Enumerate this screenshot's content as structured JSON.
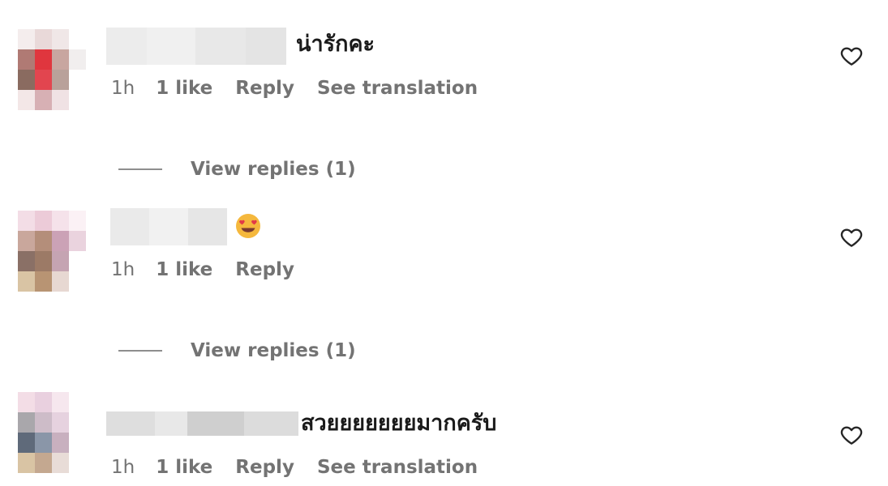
{
  "comments": [
    {
      "text": "น่ารักคะ",
      "time": "1h",
      "likes": "1 like",
      "reply_label": "Reply",
      "translation_label": "See translation",
      "view_replies": "View replies (1)"
    },
    {
      "emoji": "smiling-face-with-heart-eyes",
      "time": "1h",
      "likes": "1 like",
      "reply_label": "Reply",
      "view_replies": "View replies (1)"
    },
    {
      "text": "สวยยยยยยยมากครับ",
      "time": "1h",
      "likes": "1 like",
      "reply_label": "Reply",
      "translation_label": "See translation"
    }
  ],
  "icons": {
    "like": "heart-outline-icon"
  },
  "colors": {
    "secondary_text": "#737373",
    "primary_text": "#1a1a1a"
  }
}
